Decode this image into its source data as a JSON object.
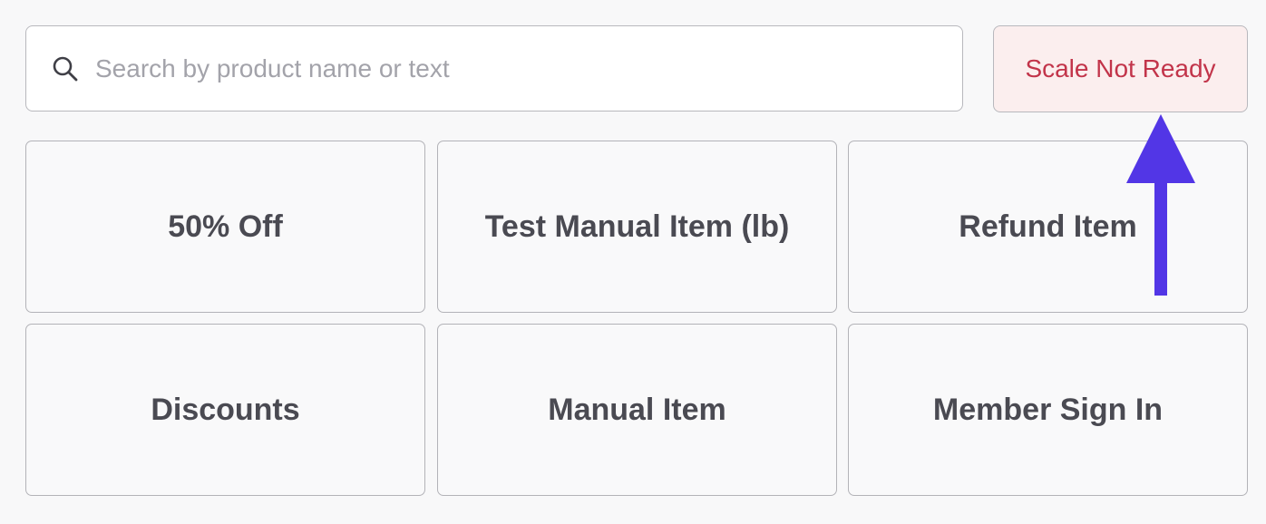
{
  "search": {
    "placeholder": "Search by product name or text",
    "value": "",
    "icon": "search-icon"
  },
  "scale_status": {
    "label": "Scale Not Ready",
    "text_color": "#c2344a",
    "background": "#fbeeee"
  },
  "tiles": [
    {
      "label": "50% Off"
    },
    {
      "label": "Test Manual Item (lb)"
    },
    {
      "label": "Refund Item"
    },
    {
      "label": "Discounts"
    },
    {
      "label": "Manual Item"
    },
    {
      "label": "Member Sign In"
    }
  ],
  "annotation": {
    "icon": "arrow-up-icon",
    "color": "#5236e6"
  }
}
